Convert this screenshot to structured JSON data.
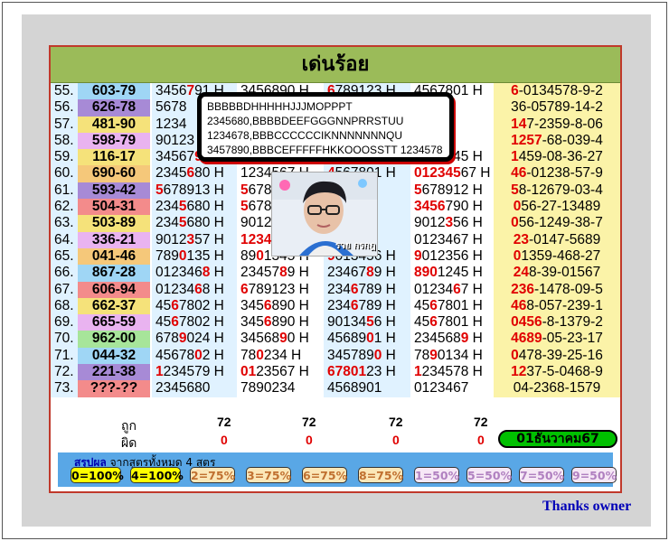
{
  "title": "เด่นร้อย",
  "rows": [
    {
      "num": "55.",
      "key": "603-79",
      "key_bg": "#9fd6f5",
      "f1": [
        [
          "345",
          ""
        ],
        [
          "6",
          ""
        ],
        [
          "7",
          "r"
        ],
        [
          "91 H",
          ""
        ]
      ],
      "f2": [
        [
          "3456890 H",
          ""
        ]
      ],
      "f3": [
        [
          "6",
          "r"
        ],
        [
          "789123 H",
          ""
        ]
      ],
      "f4": [
        [
          "4567801 H",
          ""
        ]
      ],
      "sum": [
        [
          "6",
          "r"
        ],
        [
          "-0134578-9-2",
          ""
        ]
      ]
    },
    {
      "num": "56.",
      "key": "626-78",
      "key_bg": "#a78ad6",
      "f1": [
        [
          "5678",
          ""
        ]
      ],
      "f2": [],
      "f3": [],
      "f4": [
        [
          "90 H",
          ""
        ]
      ],
      "sum": [
        [
          "36-05789-14-2",
          ""
        ]
      ]
    },
    {
      "num": "57.",
      "key": "481-90",
      "key_bg": "#f5e27a",
      "f1": [
        [
          "1234",
          ""
        ]
      ],
      "f2": [],
      "f3": [],
      "f4": [
        [
          "78 H",
          ""
        ]
      ],
      "sum": [
        [
          "1",
          "r"
        ],
        [
          "4",
          "r"
        ],
        [
          "7-2359-8-06",
          ""
        ]
      ]
    },
    {
      "num": "58.",
      "key": "598-79",
      "key_bg": "#e9b3f0",
      "f1": [
        [
          "90123",
          ""
        ]
      ],
      "f2": [],
      "f3": [],
      "f4": [
        [
          "12 H",
          ""
        ]
      ],
      "sum": [
        [
          "12",
          "r"
        ],
        [
          "57",
          "r"
        ],
        [
          "-68-039-4",
          ""
        ]
      ]
    },
    {
      "num": "59.",
      "key": "116-17",
      "key_bg": "#f5e27a",
      "f1": [
        [
          "34567",
          ""
        ],
        [
          "9",
          "r"
        ]
      ],
      "f2": [
        [
          "3456790 H",
          ""
        ]
      ],
      "f3": [
        [
          "3456901 H",
          ""
        ]
      ],
      "f4": [
        [
          "1234245 H",
          ""
        ]
      ],
      "sum": [
        [
          "1",
          "r"
        ],
        [
          "459-08-36-27",
          ""
        ]
      ]
    },
    {
      "num": "60.",
      "key": "690-60",
      "key_bg": "#f5c87a",
      "f1": [
        [
          "2345",
          ""
        ],
        [
          "6",
          "r"
        ],
        [
          "80 H",
          ""
        ]
      ],
      "f2": [
        [
          "1234567 H",
          ""
        ]
      ],
      "f3": [
        [
          "4",
          "r"
        ],
        [
          "567801 H",
          ""
        ]
      ],
      "f4": [
        [
          "012345",
          "r"
        ],
        [
          "67 H",
          ""
        ]
      ],
      "sum": [
        [
          "4",
          "r"
        ],
        [
          "6",
          "r"
        ],
        [
          "-01238-57-9",
          ""
        ]
      ]
    },
    {
      "num": "61.",
      "key": "593-42",
      "key_bg": "#a78ad6",
      "f1": [
        [
          "5",
          "r"
        ],
        [
          "678913 H",
          ""
        ]
      ],
      "f2": [
        [
          "5",
          "r"
        ],
        [
          "678",
          ""
        ]
      ],
      "f3": [
        [
          "5",
          "r"
        ]
      ],
      "f4": [
        [
          "5",
          "r"
        ],
        [
          "678912 H",
          ""
        ]
      ],
      "sum": [
        [
          "5",
          "r"
        ],
        [
          "8-12679-03-4",
          ""
        ]
      ]
    },
    {
      "num": "62.",
      "key": "504-31",
      "key_bg": "#f38b8b",
      "f1": [
        [
          "234",
          ""
        ],
        [
          "5",
          "r"
        ],
        [
          "680 H",
          ""
        ]
      ],
      "f2": [
        [
          "5",
          "r"
        ],
        [
          "678",
          ""
        ]
      ],
      "f3": [
        [
          "2 H",
          ""
        ]
      ],
      "f4": [
        [
          "34",
          "r"
        ],
        [
          "56",
          "r"
        ],
        [
          "790 H",
          ""
        ]
      ],
      "sum": [
        [
          "0",
          "r"
        ],
        [
          "56-27-13489",
          ""
        ]
      ]
    },
    {
      "num": "63.",
      "key": "503-89",
      "key_bg": "#f5e27a",
      "f1": [
        [
          "234",
          ""
        ],
        [
          "5",
          "r"
        ],
        [
          "680 H",
          ""
        ]
      ],
      "f2": [
        [
          "9012",
          ""
        ]
      ],
      "f3": [
        [
          "4 H",
          ""
        ]
      ],
      "f4": [
        [
          "9012",
          ""
        ],
        [
          "3",
          "r"
        ],
        [
          "56 H",
          ""
        ]
      ],
      "sum": [
        [
          "0",
          "r"
        ],
        [
          "56-1249-38-7",
          ""
        ]
      ]
    },
    {
      "num": "64.",
      "key": "336-21",
      "key_bg": "#e9b3f0",
      "f1": [
        [
          "9012",
          ""
        ],
        [
          "3",
          "r"
        ],
        [
          "57 H",
          ""
        ]
      ],
      "f2": [
        [
          "12",
          "r"
        ],
        [
          "345",
          "r"
        ],
        [
          "678 H",
          ""
        ]
      ],
      "f3": [
        [
          "1 H",
          ""
        ]
      ],
      "f4": [
        [
          "0123467 H",
          ""
        ]
      ],
      "sum": [
        [
          "2",
          "r"
        ],
        [
          "3",
          "r"
        ],
        [
          "-0147-5689",
          ""
        ]
      ]
    },
    {
      "num": "65.",
      "key": "041-46",
      "key_bg": "#f5c87a",
      "f1": [
        [
          "789",
          ""
        ],
        [
          "0",
          "r"
        ],
        [
          "135 H",
          ""
        ]
      ],
      "f2": [
        [
          "89",
          ""
        ],
        [
          "0",
          "r"
        ],
        [
          "1345 H",
          ""
        ]
      ],
      "f3": [
        [
          "9",
          "r"
        ],
        [
          "013456 H",
          ""
        ]
      ],
      "f4": [
        [
          "9",
          "r"
        ],
        [
          "012356 H",
          ""
        ]
      ],
      "sum": [
        [
          "0",
          "r"
        ],
        [
          "1359-468-27",
          ""
        ]
      ]
    },
    {
      "num": "66.",
      "key": "867-28",
      "key_bg": "#9fd6f5",
      "f1": [
        [
          "012346",
          ""
        ],
        [
          "8",
          "r"
        ],
        [
          " H",
          ""
        ]
      ],
      "f2": [
        [
          "23457",
          ""
        ],
        [
          "8",
          "r"
        ],
        [
          "9 H",
          ""
        ]
      ],
      "f3": [
        [
          "23467",
          ""
        ],
        [
          "8",
          "r"
        ],
        [
          "9 H",
          ""
        ]
      ],
      "f4": [
        [
          "890",
          "r"
        ],
        [
          "1245 H",
          ""
        ]
      ],
      "sum": [
        [
          "2",
          "r"
        ],
        [
          "4",
          "r"
        ],
        [
          "8-39-01567",
          ""
        ]
      ]
    },
    {
      "num": "67.",
      "key": "606-94",
      "key_bg": "#f38b8b",
      "f1": [
        [
          "01234",
          ""
        ],
        [
          "6",
          "r"
        ],
        [
          "8 H",
          ""
        ]
      ],
      "f2": [
        [
          "6",
          "r"
        ],
        [
          "789123 H",
          ""
        ]
      ],
      "f3": [
        [
          "234",
          ""
        ],
        [
          "6",
          "r"
        ],
        [
          "789 H",
          ""
        ]
      ],
      "f4": [
        [
          "01234",
          ""
        ],
        [
          "6",
          "r"
        ],
        [
          "7 H",
          ""
        ]
      ],
      "sum": [
        [
          "23",
          "r"
        ],
        [
          "6",
          "r"
        ],
        [
          "-1478-09-5",
          ""
        ]
      ]
    },
    {
      "num": "68.",
      "key": "662-37",
      "key_bg": "#f5e27a",
      "f1": [
        [
          "45",
          ""
        ],
        [
          "6",
          "r"
        ],
        [
          "7802 H",
          ""
        ]
      ],
      "f2": [
        [
          "345",
          ""
        ],
        [
          "6",
          "r"
        ],
        [
          "890 H",
          ""
        ]
      ],
      "f3": [
        [
          "234",
          ""
        ],
        [
          "6",
          "r"
        ],
        [
          "789 H",
          ""
        ]
      ],
      "f4": [
        [
          "45",
          ""
        ],
        [
          "6",
          "r"
        ],
        [
          "7801 H",
          ""
        ]
      ],
      "sum": [
        [
          "4",
          "r"
        ],
        [
          "6",
          "r"
        ],
        [
          "8-057-239-1",
          ""
        ]
      ]
    },
    {
      "num": "69.",
      "key": "665-59",
      "key_bg": "#e9b3f0",
      "f1": [
        [
          "45",
          ""
        ],
        [
          "6",
          "r"
        ],
        [
          "7802 H",
          ""
        ]
      ],
      "f2": [
        [
          "345",
          ""
        ],
        [
          "6",
          "r"
        ],
        [
          "890 H",
          ""
        ]
      ],
      "f3": [
        [
          "90134",
          ""
        ],
        [
          "5",
          "r"
        ],
        [
          "6 H",
          ""
        ]
      ],
      "f4": [
        [
          "45",
          ""
        ],
        [
          "6",
          "r"
        ],
        [
          "7801 H",
          ""
        ]
      ],
      "sum": [
        [
          "0",
          "r"
        ],
        [
          "45",
          "r"
        ],
        [
          "6",
          "r"
        ],
        [
          "-8-1379-2",
          ""
        ]
      ]
    },
    {
      "num": "70.",
      "key": "962-00",
      "key_bg": "#a7e59a",
      "f1": [
        [
          "678",
          ""
        ],
        [
          "9",
          "r"
        ],
        [
          "024 H",
          ""
        ]
      ],
      "f2": [
        [
          "34568",
          ""
        ],
        [
          "9",
          "r"
        ],
        [
          "0 H",
          ""
        ]
      ],
      "f3": [
        [
          "45689",
          ""
        ],
        [
          "0",
          "r"
        ],
        [
          "1 H",
          ""
        ]
      ],
      "f4": [
        [
          "234568",
          ""
        ],
        [
          "9",
          "r"
        ],
        [
          " H",
          ""
        ]
      ],
      "sum": [
        [
          "46",
          "r"
        ],
        [
          "8",
          "r"
        ],
        [
          "9",
          "r"
        ],
        [
          "-05-23-17",
          ""
        ]
      ]
    },
    {
      "num": "71.",
      "key": "044-32",
      "key_bg": "#9fd6f5",
      "f1": [
        [
          "45678",
          ""
        ],
        [
          "0",
          "r"
        ],
        [
          "2 H",
          ""
        ]
      ],
      "f2": [
        [
          "78",
          ""
        ],
        [
          "0",
          "r"
        ],
        [
          "234 H",
          ""
        ]
      ],
      "f3": [
        [
          "345789",
          ""
        ],
        [
          "0",
          "r"
        ],
        [
          " H",
          ""
        ]
      ],
      "f4": [
        [
          "78",
          ""
        ],
        [
          "9",
          "r"
        ],
        [
          "0134 H",
          ""
        ]
      ],
      "sum": [
        [
          "0",
          "r"
        ],
        [
          "478-39-25-16",
          ""
        ]
      ]
    },
    {
      "num": "72.",
      "key": "221-38",
      "key_bg": "#a78ad6",
      "f1": [
        [
          "1",
          "r"
        ],
        [
          "234579 H",
          ""
        ]
      ],
      "f2": [
        [
          "0",
          "r"
        ],
        [
          "1",
          "r"
        ],
        [
          "23567 H",
          ""
        ]
      ],
      "f3": [
        [
          "6780",
          "r"
        ],
        [
          "1",
          "r"
        ],
        [
          "23 H",
          ""
        ]
      ],
      "f4": [
        [
          "1",
          "r"
        ],
        [
          "234578 H",
          ""
        ]
      ],
      "sum": [
        [
          "1",
          "r"
        ],
        [
          "2",
          "r"
        ],
        [
          "37-5-0468-9",
          ""
        ]
      ]
    },
    {
      "num": "73.",
      "key": "???-??",
      "key_bg": "#f38b8b",
      "f1": [
        [
          "2345680",
          ""
        ]
      ],
      "f2": [
        [
          "7890234",
          ""
        ]
      ],
      "f3": [
        [
          "4568901",
          ""
        ]
      ],
      "f4": [
        [
          "0123467",
          ""
        ]
      ],
      "sum": [
        [
          "04-2368-1579",
          ""
        ]
      ]
    }
  ],
  "bottom": {
    "hit_label": "ถูก",
    "miss_label": "ผิด",
    "hits": [
      "72",
      "72",
      "72",
      "72"
    ],
    "misses": [
      "0",
      "0",
      "0",
      "0"
    ],
    "date": "01ธันวาคม67"
  },
  "summary": {
    "title_bold": "สรุปผล",
    "title_rest": " จากสูตรทั้งหมด 4 สูตร",
    "chips": [
      {
        "label": "0=100%",
        "bg": "#ffff00",
        "fg": "#000"
      },
      {
        "label": "4=100%",
        "bg": "#ffff00",
        "fg": "#000"
      },
      {
        "label": "2=75%",
        "bg": "#fbe7b8",
        "fg": "#c07030"
      },
      {
        "label": "3=75%",
        "bg": "#fbe7b8",
        "fg": "#c07030"
      },
      {
        "label": "6=75%",
        "bg": "#fbe7b8",
        "fg": "#c07030"
      },
      {
        "label": "8=75%",
        "bg": "#fbe7b8",
        "fg": "#c07030"
      },
      {
        "label": "1=50%",
        "bg": "#f6e8f6",
        "fg": "#b080c0"
      },
      {
        "label": "5=50%",
        "bg": "#f6e8f6",
        "fg": "#b080c0"
      },
      {
        "label": "7=50%",
        "bg": "#f6e8f6",
        "fg": "#b080c0"
      },
      {
        "label": "9=50%",
        "bg": "#f6e8f6",
        "fg": "#b080c0"
      }
    ]
  },
  "popup_lines": [
    "BBBBBDHHHHHJJJMOPPPT",
    "2345680,BBBBDEEFGGGNNPRRSTUU",
    "1234678,BBBCCCCCCIKNNNNNNNQU",
    "3457890,BBBCEFFFFFHKKOOOSSTT 1234578"
  ],
  "avatar_caption": "รวย กรกฎ",
  "thanks": "Thanks owner"
}
